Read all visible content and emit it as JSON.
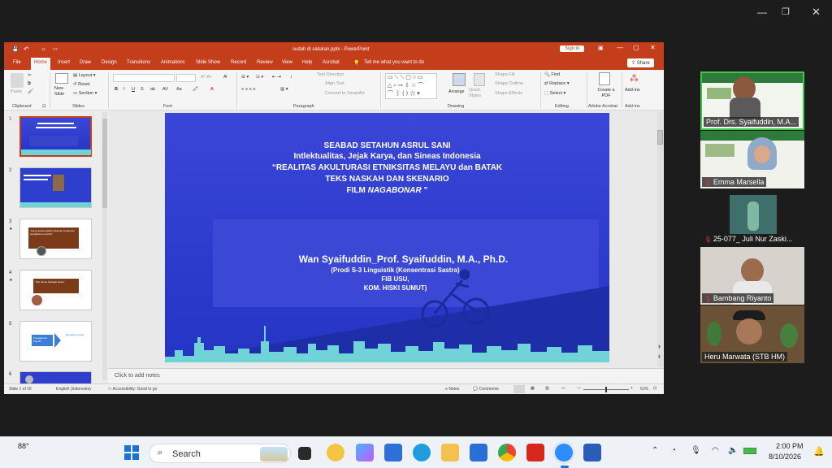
{
  "titlebar": {
    "doc_title": "sudah di satukan.pptx  -  PowerPoint",
    "sign_in": "Sign in"
  },
  "menu": {
    "items": [
      "File",
      "Home",
      "Insert",
      "Draw",
      "Design",
      "Transitions",
      "Animations",
      "Slide Show",
      "Record",
      "Review",
      "View",
      "Help",
      "Acrobat"
    ],
    "tell_me": "Tell me what you want to do",
    "share": "Share"
  },
  "ribbon": {
    "paste": "Paste",
    "new_slide": "New Slide",
    "layout": "Layout",
    "reset": "Reset",
    "section": "Section",
    "text_direction": "Text Direction",
    "align_text": "Align Text",
    "convert_smartart": "Convert to SmartArt",
    "arrange": "Arrange",
    "quick_styles": "Quick Styles",
    "shape_fill": "Shape Fill",
    "shape_outline": "Shape Outline",
    "shape_effects": "Shape Effects",
    "find": "Find",
    "replace": "Replace",
    "select": "Select",
    "create_pdf": "Create a PDF",
    "addins": "Add-ins",
    "groups": {
      "clipboard": "Clipboard",
      "slides": "Slides",
      "font": "Font",
      "paragraph": "Paragraph",
      "drawing": "Drawing",
      "editing": "Editing",
      "adobe": "Adobe Acrobat",
      "addins": "Add-ins"
    }
  },
  "thumbnails": {
    "numbers": [
      "1",
      "2",
      "3",
      "4",
      "5",
      "6"
    ],
    "slide3_text": "“Karya sastra adalah rekaman sosial dari pengalaman penulis”",
    "slide4_text": "“Aku hanya Sebagai hutan”",
    "slide5_left": "Pengalaman Penulis",
    "slide5_right": "Pemikiran sosial"
  },
  "slide": {
    "line1": "SEABAD SETAHUN ASRUL SANI",
    "line2": "Intlektualitas, Jejak Karya, dan Sineas Indonesia",
    "line3": "“REALITAS AKULTURASI  ETNIKSITAS MELAYU dan BATAK",
    "line4": "TEKS NASKAH DAN SKENARIO",
    "line5a": "FILM ",
    "line5b": "NAGABONAR",
    "line5c": " ”",
    "author": "Wan Syaifuddin_Prof. Syaifuddin, M.A., Ph.D.",
    "sub1": "(Prodi S-3 Linguistik (Konsentrasi Sastra)",
    "sub2": "FIB USU,",
    "sub3": "KOM. HISKI SUMUT)"
  },
  "notes_placeholder": "Click to add notes",
  "status": {
    "slide_count": "Slide 1 of 16",
    "language": "English (Indonesia)",
    "accessibility": "Accessibility: Good to go",
    "notes": "Notes",
    "comments": "Comments",
    "zoom": "61%"
  },
  "participants": [
    {
      "name": "Prof. Drs. Syaifuddin, M.A..."
    },
    {
      "name": "Emma Marsella"
    },
    {
      "name": "25-077_ Juli Nur Zaski..."
    },
    {
      "name": "Bambang Riyanto"
    },
    {
      "name": "Heru Marwata (STB HM)"
    }
  ],
  "taskbar": {
    "weather": "88°",
    "search_placeholder": "Search",
    "time": "2:00 PM",
    "date": "8/10/2026"
  },
  "colors": {
    "ppt_red": "#c43e1c",
    "slide_blue": "#2f3fd2",
    "active_speaker": "#3ec84a"
  }
}
